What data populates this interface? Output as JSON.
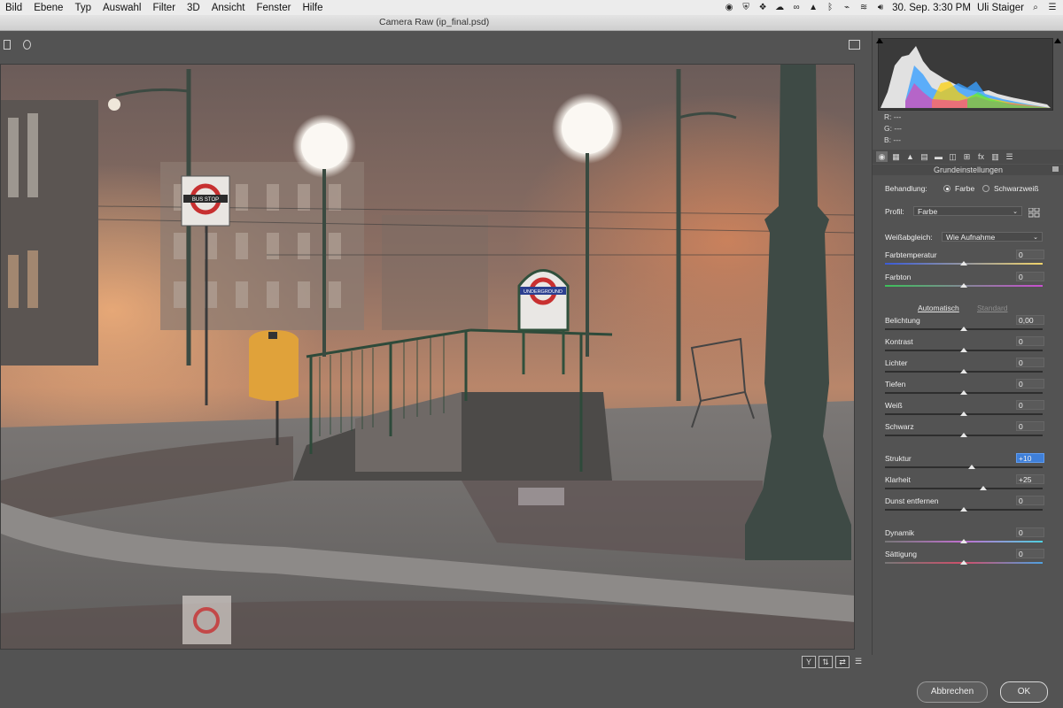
{
  "menubar": {
    "items": [
      "Bild",
      "Ebene",
      "Typ",
      "Auswahl",
      "Filter",
      "3D",
      "Ansicht",
      "Fenster",
      "Hilfe"
    ],
    "clock": "30. Sep. 3:30 PM",
    "user": "Uli Staiger"
  },
  "window": {
    "title": "Camera Raw (ip_final.psd)"
  },
  "image": {
    "sign_bus": "BUS STOP",
    "sign_underground": "UNDERGROUND"
  },
  "readout": {
    "r": "R:",
    "r_val": "---",
    "g": "G:",
    "g_val": "---",
    "b": "B:",
    "b_val": "---"
  },
  "panel": {
    "section_title": "Grundeinstellungen",
    "treatment_label": "Behandlung:",
    "treatment_color": "Farbe",
    "treatment_bw": "Schwarzweiß",
    "profile_label": "Profil:",
    "profile_value": "Farbe",
    "wb_label": "Weißabgleich:",
    "wb_value": "Wie Aufnahme",
    "auto_label": "Automatisch",
    "default_label": "Standard",
    "sliders": [
      {
        "label": "Farbtemperatur",
        "value": "0",
        "pos": 0.5
      },
      {
        "label": "Farbton",
        "value": "0",
        "pos": 0.5
      },
      {
        "label": "Belichtung",
        "value": "0,00",
        "pos": 0.5
      },
      {
        "label": "Kontrast",
        "value": "0",
        "pos": 0.5
      },
      {
        "label": "Lichter",
        "value": "0",
        "pos": 0.5
      },
      {
        "label": "Tiefen",
        "value": "0",
        "pos": 0.5
      },
      {
        "label": "Weiß",
        "value": "0",
        "pos": 0.5
      },
      {
        "label": "Schwarz",
        "value": "0",
        "pos": 0.5
      },
      {
        "label": "Struktur",
        "value": "+10",
        "pos": 0.55
      },
      {
        "label": "Klarheit",
        "value": "+25",
        "pos": 0.625
      },
      {
        "label": "Dunst entfernen",
        "value": "0",
        "pos": 0.5
      },
      {
        "label": "Dynamik",
        "value": "0",
        "pos": 0.5
      },
      {
        "label": "Sättigung",
        "value": "0",
        "pos": 0.5
      }
    ]
  },
  "footer": {
    "cancel": "Abbrechen",
    "ok": "OK"
  },
  "colors": {
    "accent": "#3f7fd8",
    "panel": "#535353"
  }
}
